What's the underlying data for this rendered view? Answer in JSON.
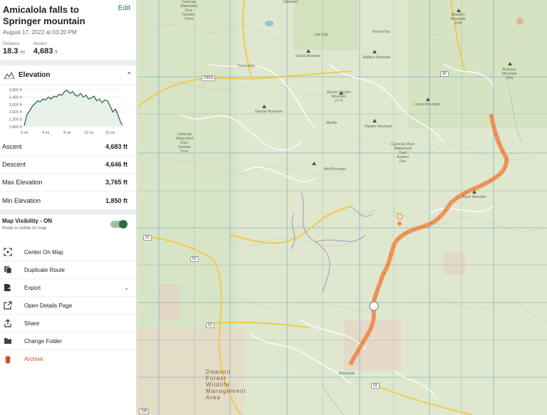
{
  "route": {
    "title": "Amicalola falls to Springer mountain",
    "edit_label": "Edit",
    "date": "August 17, 2022 at 03:20 PM",
    "distance_label": "Distance",
    "distance_value": "18.3",
    "distance_unit": "mi",
    "ascent_label": "Ascent",
    "ascent_value": "4,683",
    "ascent_unit": "ft"
  },
  "elevation": {
    "title": "Elevation",
    "icon": "mountain-icon",
    "collapse_icon": "chevron-up-icon",
    "stats": [
      {
        "label": "Ascent",
        "value": "4,683 ft"
      },
      {
        "label": "Descent",
        "value": "4,646 ft"
      },
      {
        "label": "Max Elevation",
        "value": "3,765 ft"
      },
      {
        "label": "Min Elevation",
        "value": "1,850 ft"
      }
    ]
  },
  "chart_data": {
    "type": "area",
    "title": "",
    "xlabel": "",
    "ylabel": "",
    "x_ticks": [
      "0 mi",
      "4 mi",
      "8 mi",
      "12 mi",
      "16 mi"
    ],
    "y_ticks": [
      "3,800 ft",
      "3,400 ft",
      "3,000 ft",
      "2,600 ft",
      "2,200 ft",
      "1,800 ft"
    ],
    "xlim": [
      0,
      18.3
    ],
    "ylim": [
      1800,
      3800
    ],
    "grid": true,
    "x": [
      0,
      0.5,
      1,
      1.5,
      2,
      2.5,
      3,
      3.5,
      4,
      4.5,
      5,
      5.5,
      6,
      6.5,
      7,
      7.5,
      8,
      8.5,
      9,
      9.5,
      10,
      10.5,
      11,
      11.5,
      12,
      12.5,
      13,
      13.5,
      14,
      14.5,
      15,
      15.5,
      16,
      16.5,
      17,
      17.5,
      18,
      18.3
    ],
    "values": [
      1850,
      2450,
      2650,
      2900,
      3050,
      3200,
      3150,
      3300,
      3250,
      3400,
      3300,
      3450,
      3400,
      3550,
      3500,
      3700,
      3765,
      3600,
      3700,
      3500,
      3450,
      3600,
      3400,
      3500,
      3300,
      3350,
      3450,
      3200,
      3300,
      3100,
      3250,
      3200,
      2900,
      2600,
      2750,
      2400,
      2000,
      1900
    ]
  },
  "visibility": {
    "title": "Map Visibility - ON",
    "subtitle": "Route is visible on map",
    "on": true
  },
  "actions": [
    {
      "label": "Center On Map",
      "icon": "center-map-icon"
    },
    {
      "label": "Duplicate Route",
      "icon": "duplicate-icon"
    },
    {
      "label": "Export",
      "icon": "export-icon",
      "has_dropdown": true
    },
    {
      "label": "Open Details Page",
      "icon": "external-link-icon"
    },
    {
      "label": "Share",
      "icon": "share-icon"
    },
    {
      "label": "Change Folder",
      "icon": "folder-icon"
    },
    {
      "label": "Archive",
      "icon": "trash-icon"
    }
  ],
  "colors": {
    "accent": "#2e6b45",
    "route": "#f08a4b",
    "archive": "#d24a2c",
    "map_base": "#dfe8cf"
  },
  "map": {
    "labels": {
      "bearden": "Bearden\nMountain\n3240",
      "buckeye": "Buckeye\nMountain\n3241",
      "locust": "Locust Mountain",
      "wallace": "Wallace Mountain",
      "gould": "Gould Mountain",
      "low_gap": "Low Gap",
      "marion": "Marion Clayton\nMountain\n2772",
      "george": "George Mountain",
      "hawkin": "Hawkin Mountain",
      "bird": "Bird Mountain",
      "black": "Black Mountain",
      "cartecay_top": "Cartecay\nWatershed\nDam\nNumber\nThree",
      "cartecay_mid": "Cartecay\nWatershed\nDam\nNumber\nFour",
      "cartecay_right": "Cartecay River\nWatershed\nDam\nNumber\nFive",
      "diamond": "Diamond",
      "tickanetley": "Tickanetley",
      "marble": "Marble",
      "roundtop": "Round Top",
      "amicalola": "Amicalola",
      "wma": "Dawson\nForest\nWildlife\nManagement\nArea"
    },
    "shields": {
      "cr": "CR18",
      "r52a": "52",
      "r52b": "52",
      "r52c": "52",
      "r53": "53",
      "r42": "42",
      "r136": "136"
    }
  }
}
